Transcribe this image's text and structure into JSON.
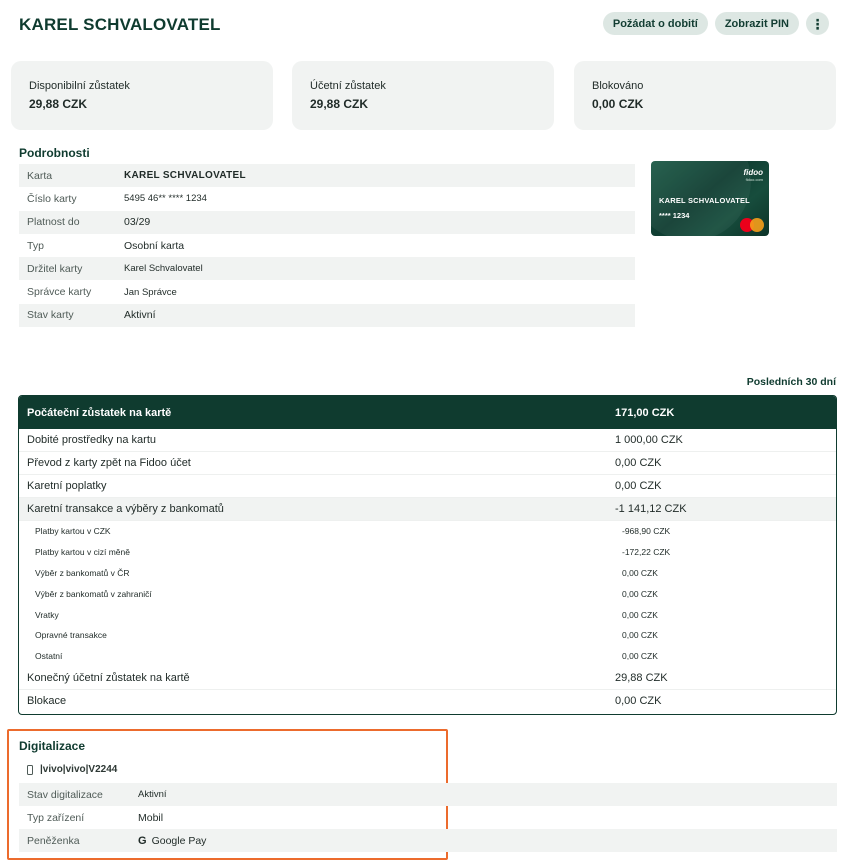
{
  "header": {
    "title": "KAREL SCHVALOVATEL",
    "request_topup_label": "Požádat o dobití",
    "show_pin_label": "Zobrazit PIN",
    "more_icon": "⋮"
  },
  "balances": [
    {
      "label": "Disponibilní zůstatek",
      "value": "29,88 CZK"
    },
    {
      "label": "Účetní zůstatek",
      "value": "29,88 CZK"
    },
    {
      "label": "Blokováno",
      "value": "0,00 CZK"
    }
  ],
  "details": {
    "title": "Podrobnosti",
    "rows": [
      {
        "label": "Karta",
        "value": "KAREL SCHVALOVATEL"
      },
      {
        "label": "Číslo karty",
        "value": "5495 46** **** 1234"
      },
      {
        "label": "Platnost do",
        "value": "03/29"
      },
      {
        "label": "Typ",
        "value": "Osobní karta"
      },
      {
        "label": "Držitel karty",
        "value": "Karel Schvalovatel"
      },
      {
        "label": "Správce karty",
        "value": "Jan Správce"
      },
      {
        "label": "Stav karty",
        "value": "Aktivní"
      }
    ]
  },
  "card_visual": {
    "logo": "fidoo",
    "logo_sub": "fidoo.com",
    "name": "KAREL SCHVALOVATEL",
    "number": "**** 1234",
    "network_icon": "mastercard-icon"
  },
  "summary": {
    "period": "Posledních 30 dní",
    "head": {
      "label": "Počáteční zůstatek na kartě",
      "value": "171,00 CZK"
    },
    "rows": [
      {
        "label": "Dobité prostředky na kartu",
        "value": "1 000,00 CZK"
      },
      {
        "label": "Převod z karty zpět na Fidoo účet",
        "value": "0,00 CZK"
      },
      {
        "label": "Karetní poplatky",
        "value": "0,00 CZK"
      },
      {
        "label": "Karetní transakce a výběry z bankomatů",
        "value": "-1 141,12 CZK"
      }
    ],
    "sub_rows": [
      {
        "label": "Platby kartou v CZK",
        "value": "-968,90 CZK"
      },
      {
        "label": "Platby kartou v cizí měně",
        "value": "-172,22 CZK"
      },
      {
        "label": "Výběr z bankomatů v ČR",
        "value": "0,00 CZK"
      },
      {
        "label": "Výběr z bankomatů v zahraničí",
        "value": "0,00 CZK"
      },
      {
        "label": "Vratky",
        "value": "0,00 CZK"
      },
      {
        "label": "Opravné transakce",
        "value": "0,00 CZK"
      },
      {
        "label": "Ostatní",
        "value": "0,00 CZK"
      }
    ],
    "final_rows": [
      {
        "label": "Konečný účetní zůstatek na kartě",
        "value": "29,88 CZK"
      },
      {
        "label": "Blokace",
        "value": "0,00 CZK"
      }
    ]
  },
  "digitalization": {
    "title": "Digitalizace",
    "device": "|vivo|vivo|V2244",
    "rows": [
      {
        "label": "Stav digitalizace",
        "value": "Aktivní"
      },
      {
        "label": "Typ zařízení",
        "value": "Mobil"
      },
      {
        "label": "Peněženka",
        "value": "Google Pay"
      }
    ],
    "wallet_icon": "G"
  },
  "colors": {
    "brand_dark": "#0f3b2f",
    "highlight": "#ec6b2d",
    "card_bg": "#f1f3f2"
  }
}
